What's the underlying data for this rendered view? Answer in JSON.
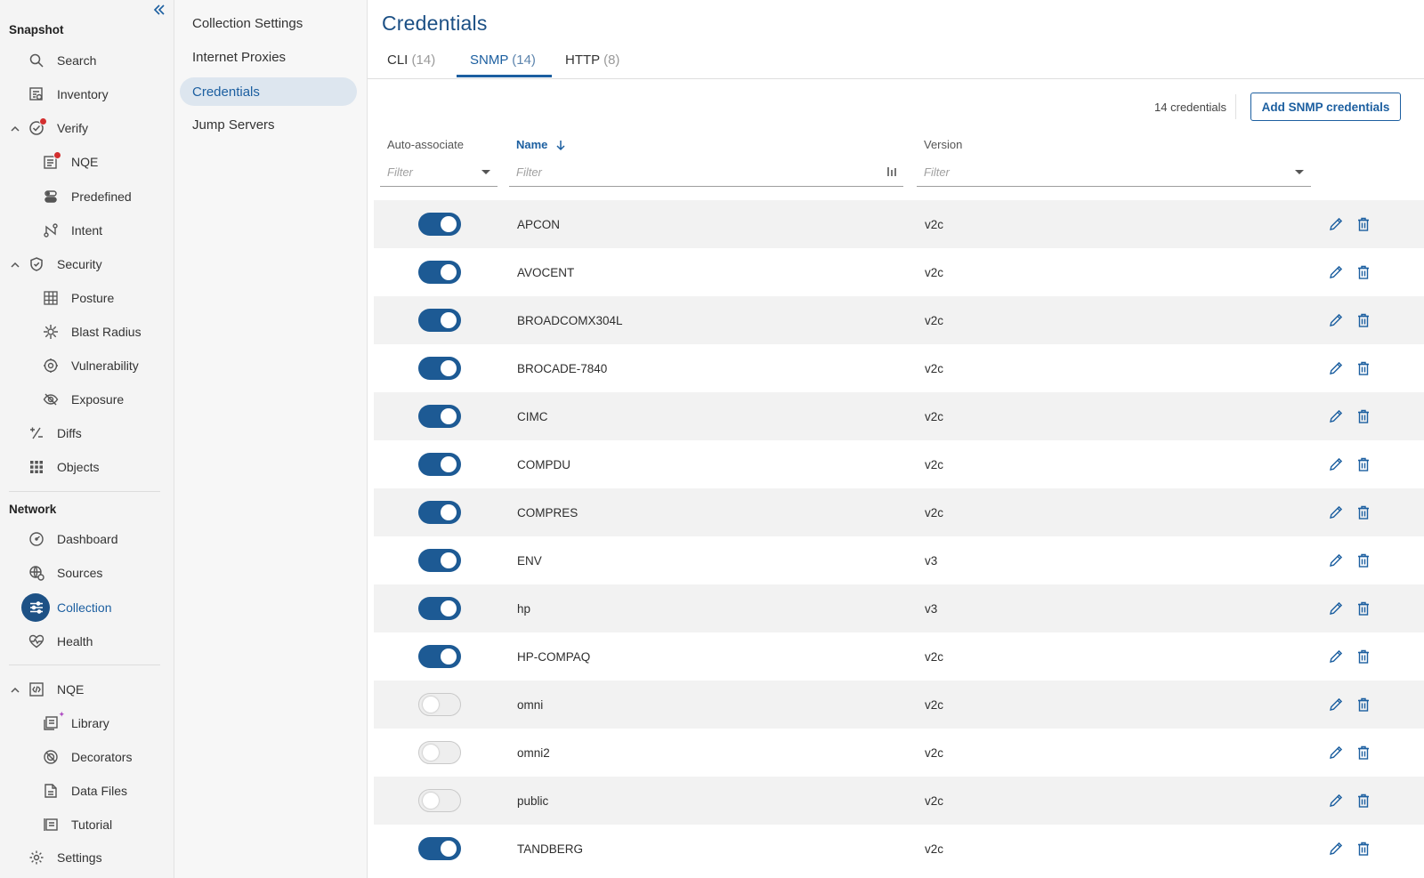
{
  "nav": {
    "snapshot_label": "Snapshot",
    "search": "Search",
    "inventory": "Inventory",
    "verify": "Verify",
    "nqe": "NQE",
    "predefined": "Predefined",
    "intent": "Intent",
    "security": "Security",
    "posture": "Posture",
    "blast_radius": "Blast Radius",
    "vulnerability": "Vulnerability",
    "exposure": "Exposure",
    "diffs": "Diffs",
    "objects": "Objects",
    "network_label": "Network",
    "dashboard": "Dashboard",
    "sources": "Sources",
    "collection": "Collection",
    "health": "Health",
    "nqe_group": "NQE",
    "library": "Library",
    "decorators": "Decorators",
    "data_files": "Data Files",
    "tutorial": "Tutorial",
    "settings": "Settings"
  },
  "subnav": {
    "items": [
      "Collection Settings",
      "Internet Proxies",
      "Credentials",
      "Jump Servers"
    ]
  },
  "main": {
    "title": "Credentials",
    "tabs": [
      {
        "label": "CLI",
        "count": "(14)"
      },
      {
        "label": "SNMP",
        "count": "(14)"
      },
      {
        "label": "HTTP",
        "count": "(8)"
      }
    ],
    "active_tab": "SNMP",
    "credential_count": "14 credentials",
    "add_button": "Add SNMP credentials"
  },
  "table": {
    "headers": {
      "auto_associate": "Auto-associate",
      "name": "Name",
      "version": "Version"
    },
    "filter_placeholder": "Filter",
    "sort": {
      "column": "Name",
      "direction": "descending-arrow"
    },
    "rows": [
      {
        "auto_associate": true,
        "name": "APCON",
        "version": "v2c"
      },
      {
        "auto_associate": true,
        "name": "AVOCENT",
        "version": "v2c"
      },
      {
        "auto_associate": true,
        "name": "BROADCOMX304L",
        "version": "v2c"
      },
      {
        "auto_associate": true,
        "name": "BROCADE-7840",
        "version": "v2c"
      },
      {
        "auto_associate": true,
        "name": "CIMC",
        "version": "v2c"
      },
      {
        "auto_associate": true,
        "name": "COMPDU",
        "version": "v2c"
      },
      {
        "auto_associate": true,
        "name": "COMPRES",
        "version": "v2c"
      },
      {
        "auto_associate": true,
        "name": "ENV",
        "version": "v3"
      },
      {
        "auto_associate": true,
        "name": "hp",
        "version": "v3"
      },
      {
        "auto_associate": true,
        "name": "HP-COMPAQ",
        "version": "v2c"
      },
      {
        "auto_associate": false,
        "name": "omni",
        "version": "v2c"
      },
      {
        "auto_associate": false,
        "name": "omni2",
        "version": "v2c"
      },
      {
        "auto_associate": false,
        "name": "public",
        "version": "v2c"
      },
      {
        "auto_associate": true,
        "name": "TANDBERG",
        "version": "v2c"
      }
    ]
  },
  "colors": {
    "accent": "#1c5fa0",
    "toggle_on": "#1d5a94",
    "active_nav": "#1d5185",
    "alert_badge": "#d32f2f"
  },
  "icons": {
    "row_actions": [
      "pencil-icon",
      "trash-icon"
    ]
  }
}
